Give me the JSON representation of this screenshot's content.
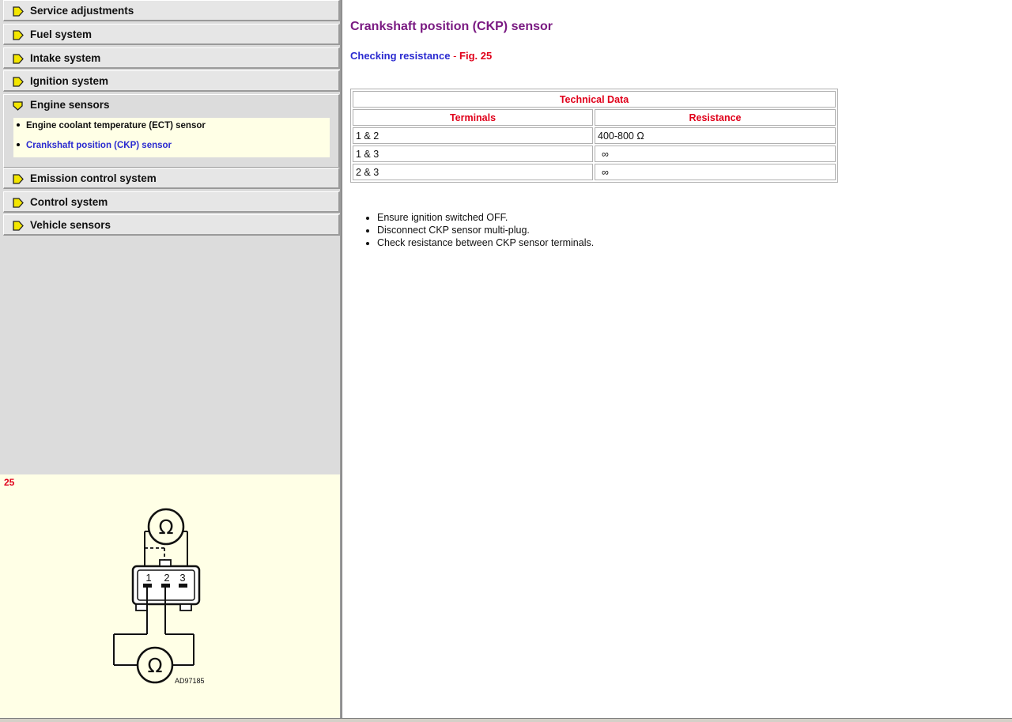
{
  "sidebar": {
    "sections": [
      {
        "label": "Service adjustments",
        "icon": "arrow-right-icon",
        "expanded": false
      },
      {
        "label": "Fuel system",
        "icon": "arrow-right-icon",
        "expanded": false
      },
      {
        "label": "Intake system",
        "icon": "arrow-right-icon",
        "expanded": false
      },
      {
        "label": "Ignition system",
        "icon": "arrow-right-icon",
        "expanded": false
      },
      {
        "label": "Engine sensors",
        "icon": "arrow-down-icon",
        "expanded": true
      },
      {
        "label": "Emission control system",
        "icon": "arrow-right-icon",
        "expanded": false
      },
      {
        "label": "Control system",
        "icon": "arrow-right-icon",
        "expanded": false
      },
      {
        "label": "Vehicle sensors",
        "icon": "arrow-right-icon",
        "expanded": false
      }
    ],
    "subitems": [
      {
        "label": "Engine coolant temperature (ECT) sensor",
        "active": false
      },
      {
        "label": "Crankshaft position (CKP) sensor",
        "active": true
      }
    ]
  },
  "figure": {
    "number": "25",
    "code": "AD97185",
    "terminal_labels": [
      "1",
      "2",
      "3"
    ],
    "ohm_symbol": "Ω"
  },
  "content": {
    "title": "Crankshaft position (CKP) sensor",
    "subheading": "Checking resistance",
    "subheading_sep": " - ",
    "fig_ref": "Fig. 25",
    "table": {
      "caption": "Technical Data",
      "columns": [
        "Terminals",
        "Resistance"
      ],
      "rows": [
        [
          "1 & 2",
          "400-800 Ω"
        ],
        [
          "1 & 3",
          "∞"
        ],
        [
          "2 & 3",
          "∞"
        ]
      ]
    },
    "steps": [
      "Ensure ignition switched OFF.",
      "Disconnect CKP sensor multi-plug.",
      "Check resistance between CKP sensor terminals."
    ]
  },
  "colors": {
    "title": "#7a1a82",
    "link": "#2a2ad0",
    "accent_red": "#e0001a",
    "panel_yellow": "#ffffe6",
    "icon_yellow": "#f3e600"
  }
}
